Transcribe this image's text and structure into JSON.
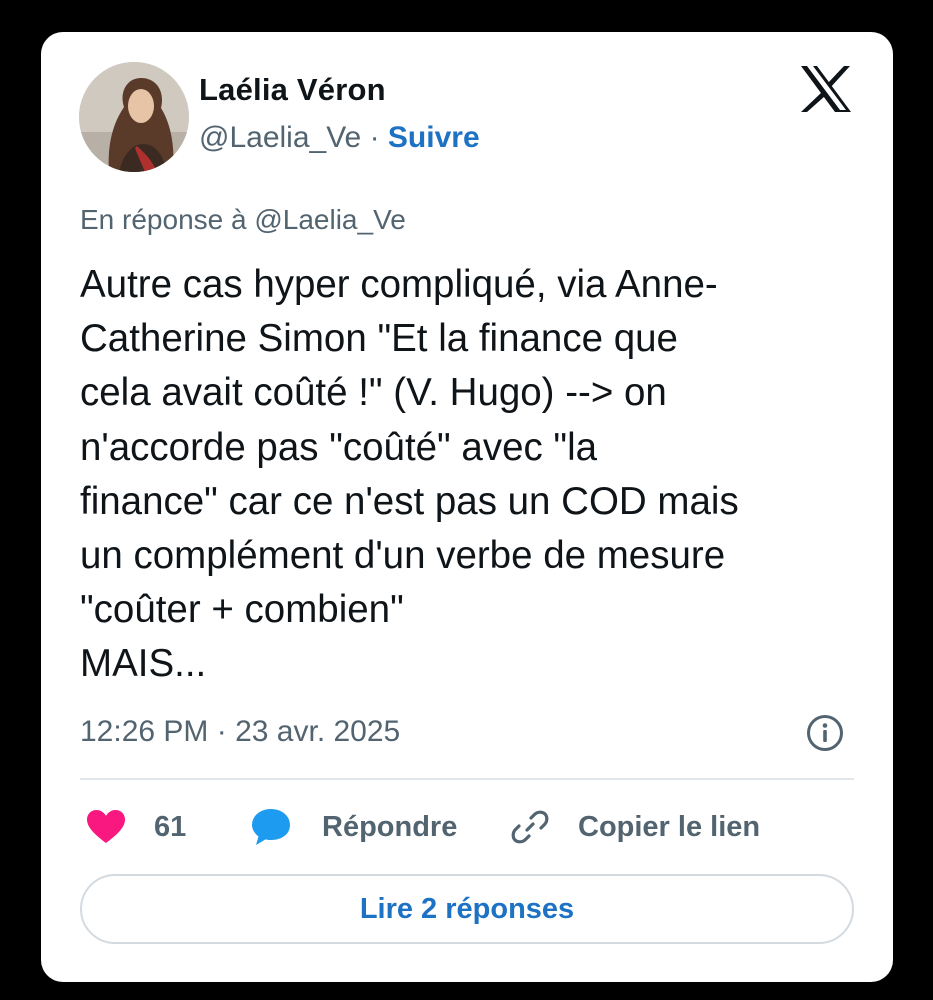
{
  "tweet": {
    "author": {
      "name": "Laélia Véron",
      "handle": "@Laelia_Ve",
      "separator": " · ",
      "follow_label": "Suivre"
    },
    "reply_to": "En réponse à @Laelia_Ve",
    "text": "Autre cas hyper compliqué, via Anne-\nCatherine Simon \"Et la finance que\ncela avait coûté !\" (V. Hugo) --> on\nn'accorde pas  \"coûté\" avec \"la\nfinance\" car ce n'est pas un COD mais\nun complément  d'un verbe de mesure\n\"coûter + combien\"\nMAIS...",
    "time": "12:26 PM",
    "date_separator": " · ",
    "date": "23 avr. 2025",
    "actions": {
      "likes": "61",
      "reply_label": "Répondre",
      "copy_link_label": "Copier le lien"
    },
    "read_replies_label": "Lire 2 réponses"
  },
  "icons": {
    "logo": "x-logo-icon",
    "info": "info-icon",
    "like": "heart-icon",
    "reply": "speech-bubble-icon",
    "copy": "link-icon"
  },
  "colors": {
    "background": "#000000",
    "card": "#ffffff",
    "text": "#0f1419",
    "secondary_text": "#536471",
    "link": "#1d72c4",
    "heart": "#f91880",
    "reply_bubble": "#1d9bf0"
  }
}
